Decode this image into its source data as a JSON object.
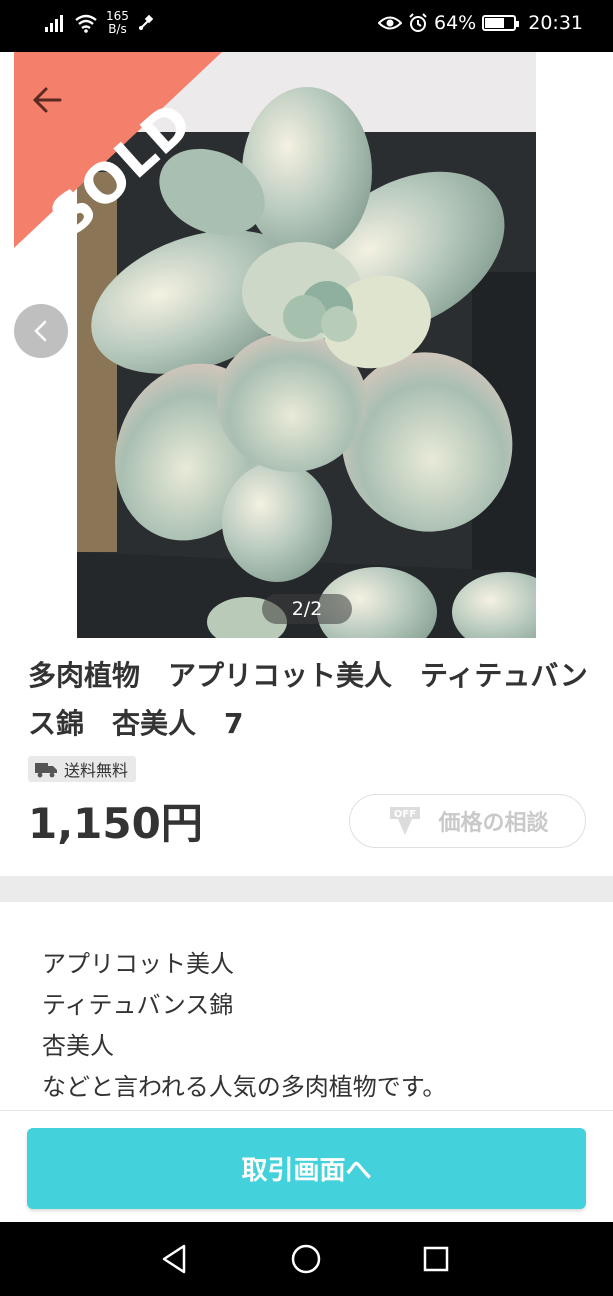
{
  "status_bar": {
    "net_speed_value": "165",
    "net_speed_unit": "B/s",
    "battery_percent": "64%",
    "time": "20:31",
    "battery_level": 0.64,
    "icons": [
      "signal-icon",
      "wifi-icon",
      "usb-icon",
      "eye-icon",
      "alarm-icon",
      "battery-icon"
    ]
  },
  "image": {
    "sold_label": "SOLD",
    "page_indicator": "2/2"
  },
  "product": {
    "title": "多肉植物　アプリコット美人　ティテュバンス錦　杏美人　7",
    "shipping_badge": "送料無料",
    "price": "1,150円",
    "offer_label": "価格の相談",
    "offer_icon_text": "OFF"
  },
  "description": {
    "lines": [
      "アプリコット美人",
      "ティテュバンス錦",
      "杏美人",
      "などと言われる人気の多肉植物です。"
    ]
  },
  "actions": {
    "trade_button": "取引画面へ"
  },
  "colors": {
    "sold_ribbon": "#f47f6b",
    "trade_button": "#43d1db"
  }
}
